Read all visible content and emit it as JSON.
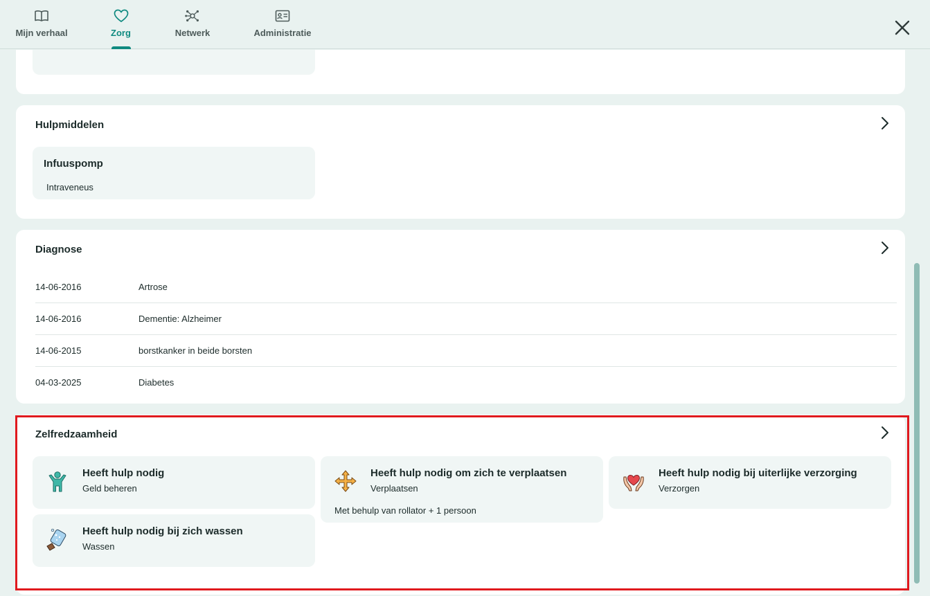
{
  "nav": {
    "tabs": [
      {
        "label": "Mijn verhaal",
        "icon": "book-icon"
      },
      {
        "label": "Zorg",
        "icon": "heart-icon",
        "active": true
      },
      {
        "label": "Netwerk",
        "icon": "network-icon"
      },
      {
        "label": "Administratie",
        "icon": "id-card-icon"
      }
    ],
    "close_icon": "close-icon"
  },
  "hulpmiddelen": {
    "title": "Hulpmiddelen",
    "items": [
      {
        "name": "Infuuspomp",
        "detail": "Intraveneus"
      }
    ]
  },
  "diagnose": {
    "title": "Diagnose",
    "rows": [
      {
        "date": "14-06-2016",
        "text": "Artrose"
      },
      {
        "date": "14-06-2016",
        "text": "Dementie: Alzheimer"
      },
      {
        "date": "14-06-2015",
        "text": "borstkanker in beide borsten"
      },
      {
        "date": "04-03-2025",
        "text": "Diabetes"
      }
    ]
  },
  "zelfredzaamheid": {
    "title": "Zelfredzaamheid",
    "items": [
      {
        "title": "Heeft hulp nodig",
        "subtitle": "Geld beheren",
        "note": "",
        "icon": "person-arms-up-icon"
      },
      {
        "title": "Heeft hulp nodig om zich te verplaatsen",
        "subtitle": "Verplaatsen",
        "note": "Met behulp van rollator + 1 persoon",
        "icon": "move-arrows-icon"
      },
      {
        "title": "Heeft hulp nodig bij uiterlijke verzorging",
        "subtitle": "Verzorgen",
        "note": "",
        "icon": "hands-heart-icon"
      },
      {
        "title": "Heeft hulp nodig bij zich wassen",
        "subtitle": "Wassen",
        "note": "",
        "icon": "washing-sponge-icon"
      }
    ]
  },
  "colors": {
    "accent": "#0f8a80",
    "background": "#e9f2f0",
    "card": "#ffffff",
    "tile": "#f0f6f5",
    "highlight": "#e0191e"
  }
}
